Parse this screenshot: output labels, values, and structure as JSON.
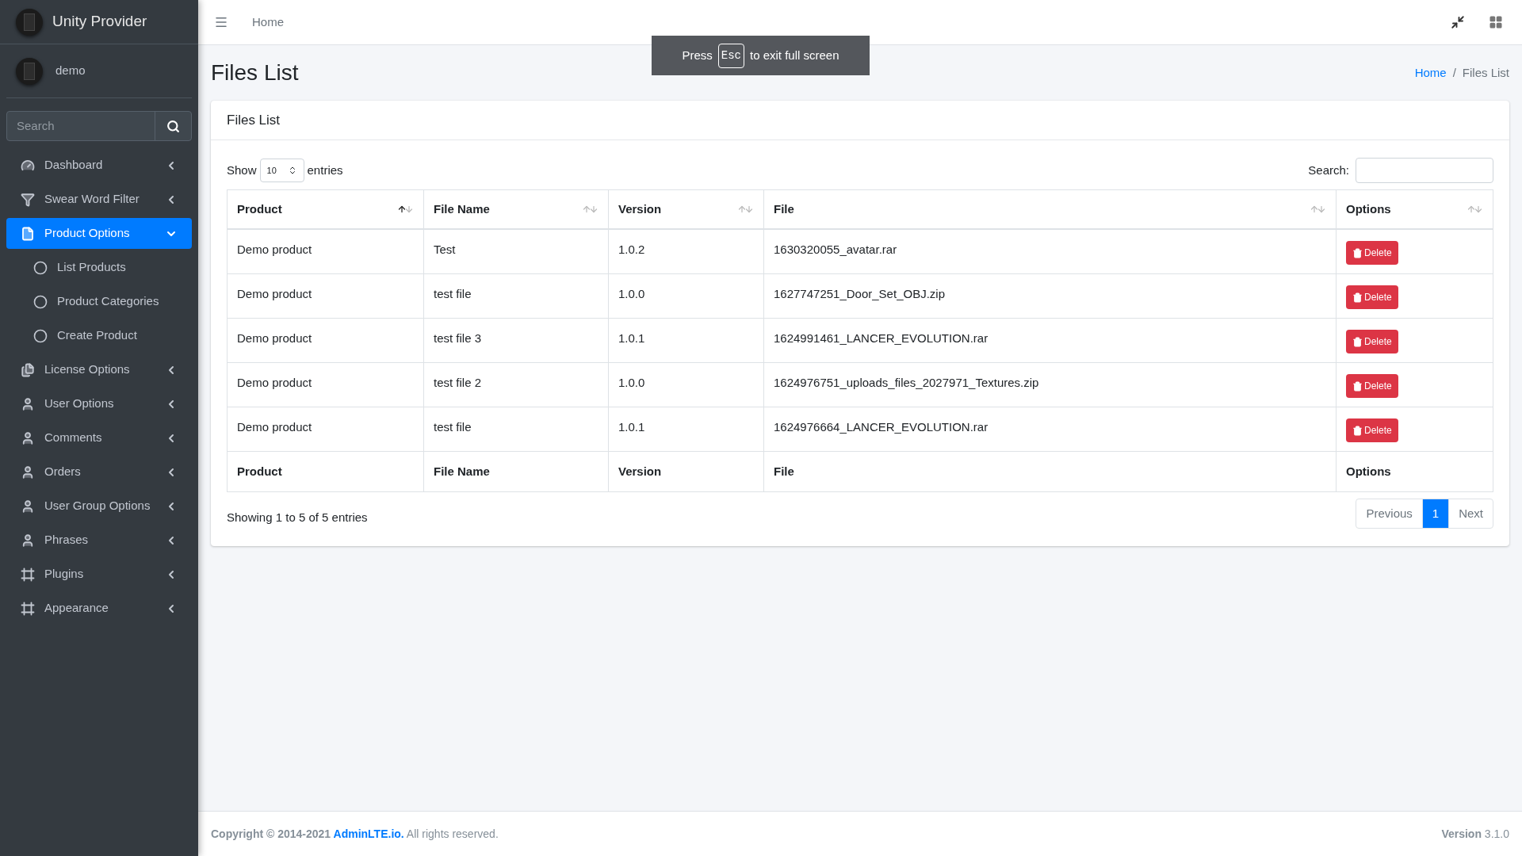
{
  "brand": {
    "name": "Unity Provider"
  },
  "user": {
    "name": "demo"
  },
  "sidebar_search": {
    "placeholder": "Search"
  },
  "sidebar": {
    "items": [
      {
        "label": "Dashboard",
        "selected": false,
        "expanded": false
      },
      {
        "label": "Swear Word Filter",
        "selected": false,
        "expanded": false
      },
      {
        "label": "Product Options",
        "selected": true,
        "expanded": true,
        "children": [
          {
            "label": "List Products"
          },
          {
            "label": "Product Categories"
          },
          {
            "label": "Create Product"
          }
        ]
      },
      {
        "label": "License Options",
        "selected": false,
        "expanded": false
      },
      {
        "label": "User Options",
        "selected": false,
        "expanded": false
      },
      {
        "label": "Comments",
        "selected": false,
        "expanded": false
      },
      {
        "label": "Orders",
        "selected": false,
        "expanded": false
      },
      {
        "label": "User Group Options",
        "selected": false,
        "expanded": false
      },
      {
        "label": "Phrases",
        "selected": false,
        "expanded": false
      },
      {
        "label": "Plugins",
        "selected": false,
        "expanded": false
      },
      {
        "label": "Appearance",
        "selected": false,
        "expanded": false
      }
    ]
  },
  "topbar": {
    "nav_link": "Home"
  },
  "fullscreen_notice": {
    "before": "Press",
    "key": "Esc",
    "after": "to exit full screen"
  },
  "page": {
    "title": "Files List",
    "breadcrumb_separator": "/",
    "breadcrumb": [
      {
        "label": "Home",
        "kind": "link"
      },
      {
        "label": "Files List",
        "kind": "current"
      }
    ]
  },
  "card": {
    "title": "Files List"
  },
  "table_controls": {
    "show": "Show",
    "page_size": "10",
    "entries": "entries",
    "search_label": "Search:"
  },
  "table": {
    "columns": [
      {
        "label": "Product",
        "sorted": true
      },
      {
        "label": "File Name",
        "sorted": false
      },
      {
        "label": "Version",
        "sorted": false
      },
      {
        "label": "File",
        "sorted": false
      },
      {
        "label": "Options",
        "sorted": false
      }
    ],
    "rows": [
      {
        "product": "Demo product",
        "file_name": "Test",
        "version": "1.0.2",
        "file": "1630320055_avatar.rar",
        "action": "Delete"
      },
      {
        "product": "Demo product",
        "file_name": "test file",
        "version": "1.0.0",
        "file": "1627747251_Door_Set_OBJ.zip",
        "action": "Delete"
      },
      {
        "product": "Demo product",
        "file_name": "test file 3",
        "version": "1.0.1",
        "file": "1624991461_LANCER_EVOLUTION.rar",
        "action": "Delete"
      },
      {
        "product": "Demo product",
        "file_name": "test file 2",
        "version": "1.0.0",
        "file": "1624976751_uploads_files_2027971_Textures.zip",
        "action": "Delete"
      },
      {
        "product": "Demo product",
        "file_name": "test file",
        "version": "1.0.1",
        "file": "1624976664_LANCER_EVOLUTION.rar",
        "action": "Delete"
      }
    ],
    "footer_columns": [
      "Product",
      "File Name",
      "Version",
      "File",
      "Options"
    ]
  },
  "table_info": "Showing 1 to 5 of 5 entries",
  "pagination": [
    {
      "label": "Previous",
      "selected": false
    },
    {
      "label": "1",
      "selected": true
    },
    {
      "label": "Next",
      "selected": false
    }
  ],
  "footer": {
    "copyright": "Copyright © 2014-2021 ",
    "link": "AdminLTE.io.",
    "rest": " All rights reserved.",
    "version": "**Version** 3.1.0"
  }
}
